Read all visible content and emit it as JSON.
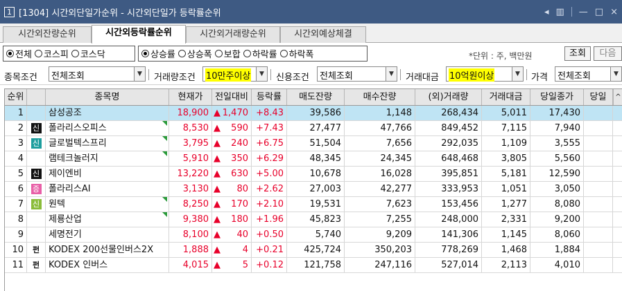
{
  "window": {
    "number": "1",
    "title": "[1304] 시간외단일가순위 - 시간외단일가 등락률순위",
    "controls": [
      "◂",
      "▥",
      "—",
      "□",
      "×"
    ]
  },
  "tabs": [
    {
      "label": "시간외잔량순위"
    },
    {
      "label": "시간외등락률순위"
    },
    {
      "label": "시간외거래량순위"
    },
    {
      "label": "시간외예상체결"
    }
  ],
  "market_options": [
    {
      "label": "전체",
      "selected": true
    },
    {
      "label": "코스피",
      "selected": false
    },
    {
      "label": "코스닥",
      "selected": false
    }
  ],
  "rank_options": [
    {
      "label": "상승률",
      "selected": true
    },
    {
      "label": "상승폭",
      "selected": false
    },
    {
      "label": "보합",
      "selected": false
    },
    {
      "label": "하락률",
      "selected": false
    },
    {
      "label": "하락폭",
      "selected": false
    }
  ],
  "unit_label": "*단위 : 주, 백만원",
  "buttons": {
    "query": "조회",
    "next": "다음"
  },
  "conditions": {
    "stock_label": "종목조건",
    "stock_value": "전체조회",
    "volume_label": "거래량조건",
    "volume_value": "10만주이상",
    "credit_label": "신용조건",
    "credit_value": "전체조회",
    "amount_label": "거래대금",
    "amount_value": "10억원이상",
    "price_label": "가격",
    "price_value": "전체조회"
  },
  "table": {
    "columns": [
      "순위",
      "",
      "종목명",
      "현재가",
      "전일대비",
      "등락률",
      "매도잔량",
      "매수잔량",
      "(외)거래량",
      "거래대금",
      "당일종가",
      "당일"
    ],
    "rows": [
      {
        "rank": "1",
        "badge": "",
        "badge_type": "",
        "name": "삼성공조",
        "price": "18,900",
        "sign": "▲",
        "change": "1,470",
        "rate": "+8.43",
        "sell_rem": "39,586",
        "buy_rem": "1,148",
        "volume": "268,434",
        "amount": "5,011",
        "close": "17,430",
        "flag": false,
        "selected": true
      },
      {
        "rank": "2",
        "badge": "신",
        "badge_type": "b-black",
        "name": "폴라리스오피스",
        "price": "8,530",
        "sign": "▲",
        "change": "590",
        "rate": "+7.43",
        "sell_rem": "27,477",
        "buy_rem": "47,766",
        "volume": "849,452",
        "amount": "7,115",
        "close": "7,940",
        "flag": true,
        "selected": false
      },
      {
        "rank": "3",
        "badge": "신",
        "badge_type": "b-teal",
        "name": "글로벌텍스프리",
        "price": "3,795",
        "sign": "▲",
        "change": "240",
        "rate": "+6.75",
        "sell_rem": "51,504",
        "buy_rem": "7,656",
        "volume": "292,035",
        "amount": "1,109",
        "close": "3,555",
        "flag": true,
        "selected": false
      },
      {
        "rank": "4",
        "badge": "",
        "badge_type": "",
        "name": "램테크놀러지",
        "price": "5,910",
        "sign": "▲",
        "change": "350",
        "rate": "+6.29",
        "sell_rem": "48,345",
        "buy_rem": "24,345",
        "volume": "648,468",
        "amount": "3,805",
        "close": "5,560",
        "flag": true,
        "selected": false
      },
      {
        "rank": "5",
        "badge": "신",
        "badge_type": "b-black",
        "name": "제이엔비",
        "price": "13,220",
        "sign": "▲",
        "change": "630",
        "rate": "+5.00",
        "sell_rem": "10,678",
        "buy_rem": "16,028",
        "volume": "395,851",
        "amount": "5,181",
        "close": "12,590",
        "flag": false,
        "selected": false
      },
      {
        "rank": "6",
        "badge": "증",
        "badge_type": "b-pink",
        "name": "폴라리스AI",
        "price": "3,130",
        "sign": "▲",
        "change": "80",
        "rate": "+2.62",
        "sell_rem": "27,003",
        "buy_rem": "42,277",
        "volume": "333,953",
        "amount": "1,051",
        "close": "3,050",
        "flag": false,
        "selected": false
      },
      {
        "rank": "7",
        "badge": "신",
        "badge_type": "b-green",
        "name": "원텍",
        "price": "8,250",
        "sign": "▲",
        "change": "170",
        "rate": "+2.10",
        "sell_rem": "19,531",
        "buy_rem": "7,623",
        "volume": "153,456",
        "amount": "1,277",
        "close": "8,080",
        "flag": true,
        "selected": false
      },
      {
        "rank": "8",
        "badge": "",
        "badge_type": "",
        "name": "제룡산업",
        "price": "9,380",
        "sign": "▲",
        "change": "180",
        "rate": "+1.96",
        "sell_rem": "45,823",
        "buy_rem": "7,255",
        "volume": "248,000",
        "amount": "2,331",
        "close": "9,200",
        "flag": true,
        "selected": false
      },
      {
        "rank": "9",
        "badge": "",
        "badge_type": "",
        "name": "세명전기",
        "price": "8,100",
        "sign": "▲",
        "change": "40",
        "rate": "+0.50",
        "sell_rem": "5,740",
        "buy_rem": "9,209",
        "volume": "141,306",
        "amount": "1,145",
        "close": "8,060",
        "flag": false,
        "selected": false
      },
      {
        "rank": "10",
        "badge": "펀",
        "badge_type": "b-none",
        "name": "KODEX 200선물인버스2X",
        "price": "1,888",
        "sign": "▲",
        "change": "4",
        "rate": "+0.21",
        "sell_rem": "425,724",
        "buy_rem": "350,203",
        "volume": "778,269",
        "amount": "1,468",
        "close": "1,884",
        "flag": false,
        "selected": false
      },
      {
        "rank": "11",
        "badge": "펀",
        "badge_type": "b-none",
        "name": "KODEX 인버스",
        "price": "4,015",
        "sign": "▲",
        "change": "5",
        "rate": "+0.12",
        "sell_rem": "121,758",
        "buy_rem": "247,116",
        "volume": "527,014",
        "amount": "2,113",
        "close": "4,010",
        "flag": false,
        "selected": false
      }
    ]
  }
}
